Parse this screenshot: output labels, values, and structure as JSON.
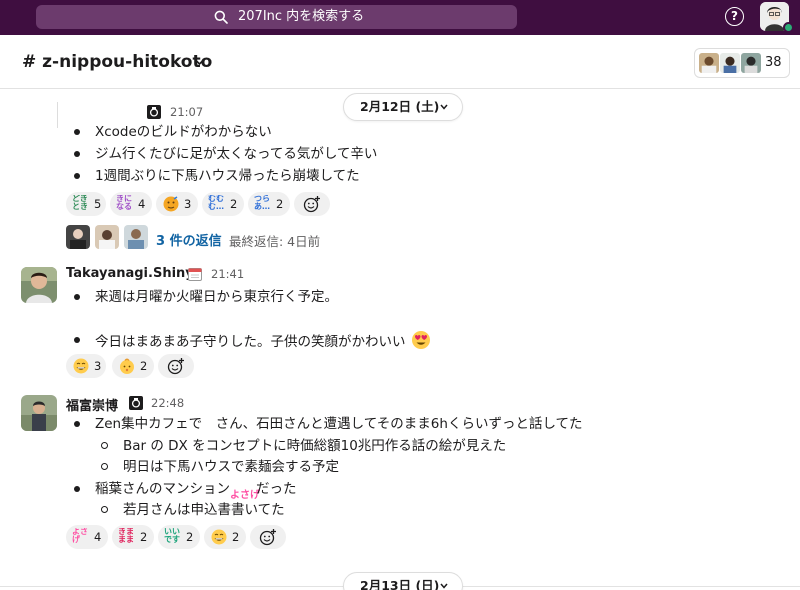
{
  "search": {
    "placeholder": "207Inc 内を検索する"
  },
  "header": {
    "help_symbol": "?"
  },
  "channel": {
    "title": "# z-nippou-hitokoto",
    "member_count": "38"
  },
  "dates": {
    "first": "2月12日 (土)",
    "second": "2月13日 (日)"
  },
  "thread_message": {
    "time": "21:07",
    "bullets": [
      "Xcodeのビルドがわからない",
      "ジム行くたびに足が太くなってる気がして辛い",
      "1週間ぶりに下馬ハウス帰ったら崩壊してた"
    ],
    "reactions": [
      {
        "emoji": "dokidoki-text",
        "count": "5"
      },
      {
        "emoji": "kininaru-text",
        "count": "4"
      },
      {
        "emoji": "hot-face",
        "count": "3"
      },
      {
        "emoji": "muzumuzu-text",
        "count": "2"
      },
      {
        "emoji": "tsurai-text",
        "count": "2"
      }
    ],
    "replies_label": "3 件の返信",
    "last_reply": "最終返信: 4日前"
  },
  "messages": [
    {
      "author": "Takayanagi.Shinya",
      "time": "21:41",
      "bullets": [
        "来週は月曜か火曜日から東京行く予定。",
        "今日はまあまあ子守りした。子供の笑顔がかわいい"
      ],
      "reactions": [
        {
          "emoji": "grinning-face",
          "count": "3"
        },
        {
          "emoji": "baby-face",
          "count": "2"
        }
      ]
    },
    {
      "author": "福富崇博",
      "time": "22:48",
      "lines": [
        {
          "text": "Zen集中カフェで　さん、石田さんと遭遇してそのまま6hくらいずっと話してた",
          "level": 1
        },
        {
          "text": "Bar の DX をコンセプトに時価総額10兆円作る話の絵が見えた",
          "level": 2
        },
        {
          "text": "明日は下馬ハウスで素麺会する予定",
          "level": 2
        },
        {
          "text": "稲葉さんのマンション",
          "suffix": "だった",
          "emoji_text": "よさげ",
          "level": 1
        },
        {
          "text": "若月さんは申込書書いてた",
          "level": 2
        }
      ],
      "reactions": [
        {
          "emoji": "yosage-text",
          "count": "4"
        },
        {
          "emoji": "kimatte-text",
          "count": "2"
        },
        {
          "emoji": "iine-text",
          "count": "2"
        },
        {
          "emoji": "grinning-face",
          "count": "2"
        }
      ]
    }
  ],
  "emoji_text": {
    "dokidoki": "どき\nとき",
    "kininaru": "きに\nなる",
    "muzumuzu": "むむ\nむ…",
    "tsurai": "つら\nあ…",
    "yosage": "よさ\nげ",
    "kimatte": "きま\nまま",
    "iine": "いい\nです"
  },
  "colors": {
    "topbar": "#3f0e40",
    "search_bg": "#6c3b6d",
    "link": "#1264a3",
    "online": "#2bac76"
  }
}
